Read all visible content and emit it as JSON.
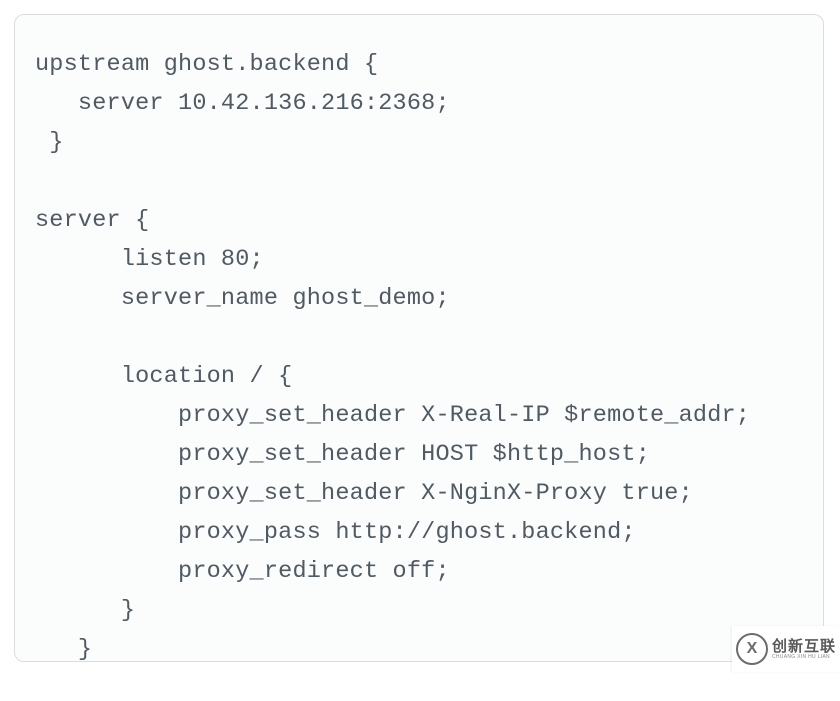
{
  "code": {
    "lines": [
      "upstream ghost.backend {",
      "   server 10.42.136.216:2368;",
      " }",
      "",
      "server {",
      "      listen 80;",
      "      server_name ghost_demo;",
      "",
      "      location / {",
      "          proxy_set_header X-Real-IP $remote_addr;",
      "          proxy_set_header HOST $http_host;",
      "          proxy_set_header X-NginX-Proxy true;",
      "          proxy_pass http://ghost.backend;",
      "          proxy_redirect off;",
      "      }",
      "   }"
    ]
  },
  "watermark": {
    "logo_letter": "X",
    "cn": "创新互联",
    "py": "CHUANG XIN HU LIAN"
  }
}
